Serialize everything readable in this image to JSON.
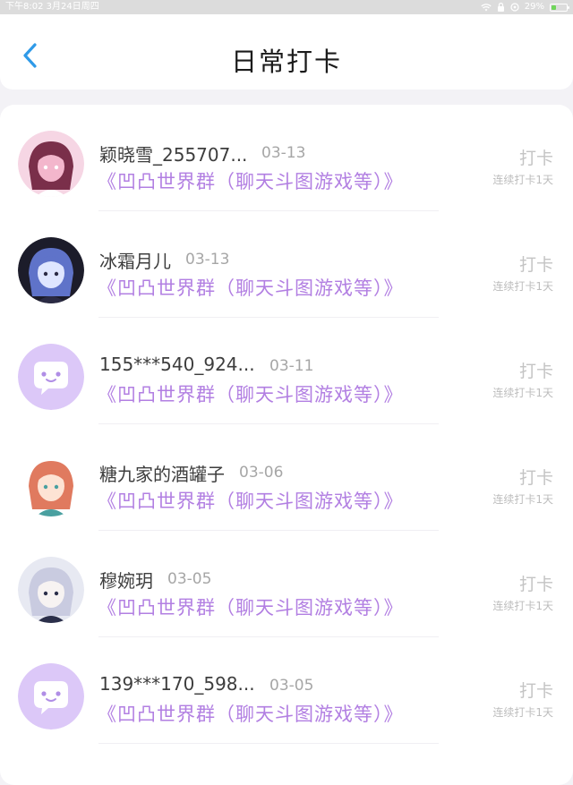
{
  "status_bar": {
    "time_date": "下午8:02   3月24日周四",
    "battery": "29%",
    "battery_level": 0.29
  },
  "header": {
    "title": "日常打卡",
    "back_icon": "chevron-left-icon"
  },
  "colors": {
    "accent_blue": "#2f9ae8",
    "group_purple": "#b27fe2",
    "default_avatar_bg": "#dcc8f8"
  },
  "list": [
    {
      "name": "颖晓雪_255707...",
      "date": "03-13",
      "group": "《凹凸世界群（聊天斗图游戏等）》",
      "action": "打卡",
      "streak": "连续打卡1天",
      "avatar": "anime-avatar-pink"
    },
    {
      "name": "冰霜月儿",
      "date": "03-13",
      "group": "《凹凸世界群（聊天斗图游戏等）》",
      "action": "打卡",
      "streak": "连续打卡1天",
      "avatar": "anime-avatar-dark"
    },
    {
      "name": "155***540_924...",
      "date": "03-11",
      "group": "《凹凸世界群（聊天斗图游戏等）》",
      "action": "打卡",
      "streak": "连续打卡1天",
      "avatar": "default-chat-avatar"
    },
    {
      "name": "糖九家的酒罐子",
      "date": "03-06",
      "group": "《凹凸世界群（聊天斗图游戏等）》",
      "action": "打卡",
      "streak": "连续打卡1天",
      "avatar": "anime-avatar-redhair"
    },
    {
      "name": "穆婉玥",
      "date": "03-05",
      "group": "《凹凸世界群（聊天斗图游戏等）》",
      "action": "打卡",
      "streak": "连续打卡1天",
      "avatar": "anime-avatar-whitehair"
    },
    {
      "name": "139***170_598...",
      "date": "03-05",
      "group": "《凹凸世界群（聊天斗图游戏等）》",
      "action": "打卡",
      "streak": "连续打卡1天",
      "avatar": "default-chat-avatar"
    }
  ]
}
